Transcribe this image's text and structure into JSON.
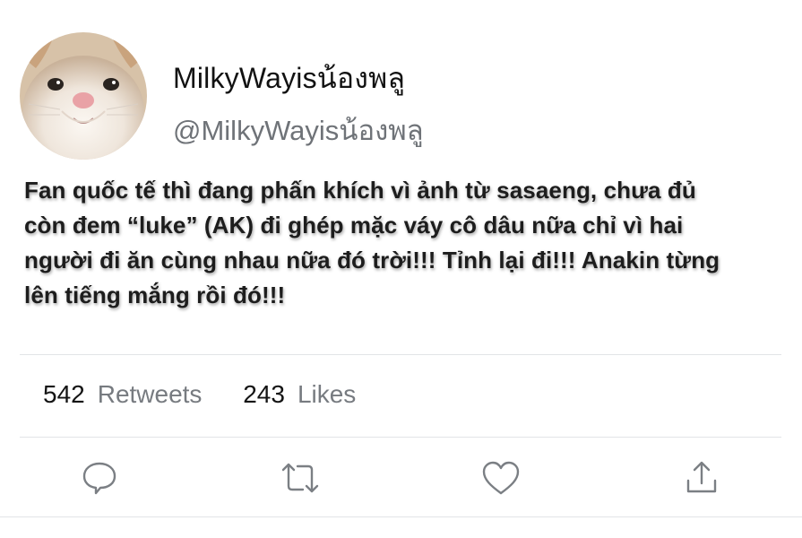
{
  "user": {
    "display_name": "MilkyWayisน้องพลู",
    "handle": "@MilkyWayisน้องพลู",
    "avatar": "cat-face-avatar"
  },
  "tweet": {
    "text": "Fan quốc tế thì đang phấn khích vì ảnh từ sasaeng, chưa đủ\ncòn đem “luke” (AK) đi ghép mặc váy cô dâu nữa chỉ vì hai\nngười đi ăn cùng nhau nữa đó trời!!! Tỉnh lại đi!!! Anakin từng\nlên tiếng mắng rồi đó!!!"
  },
  "stats": {
    "retweets_count": "542",
    "retweets_label": "Retweets",
    "likes_count": "243",
    "likes_label": "Likes"
  },
  "actions": [
    {
      "name": "reply",
      "icon": "speech-bubble-icon"
    },
    {
      "name": "retweet",
      "icon": "retweet-icon"
    },
    {
      "name": "like",
      "icon": "heart-icon"
    },
    {
      "name": "share",
      "icon": "share-icon"
    }
  ],
  "colors": {
    "text": "#1d1d1d",
    "muted": "#777b80",
    "icon": "#7b7f84",
    "divider": "#e2e4e7"
  }
}
